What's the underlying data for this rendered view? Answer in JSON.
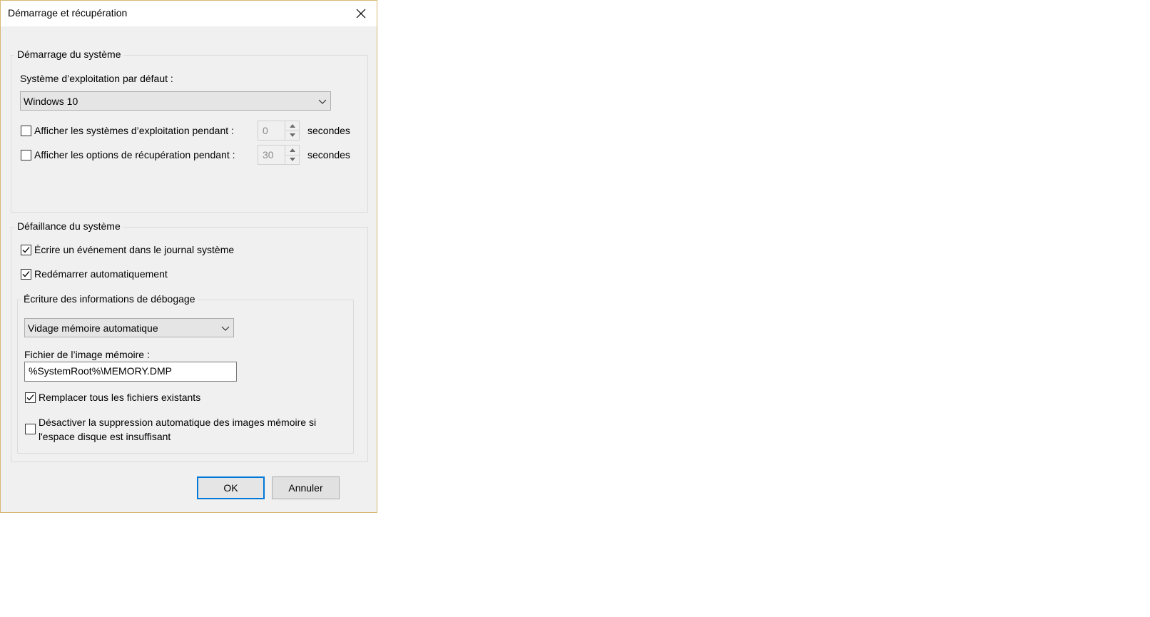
{
  "window": {
    "title": "Démarrage et récupération"
  },
  "startup": {
    "group_label": "Démarrage du système",
    "default_os_label": "Système d’exploitation par défaut :",
    "default_os_value": "Windows 10",
    "show_os_list": {
      "label": "Afficher les systèmes d’exploitation pendant :",
      "checked": false,
      "value": "0",
      "unit": "secondes"
    },
    "show_recovery": {
      "label": "Afficher les options de récupération pendant :",
      "checked": false,
      "value": "30",
      "unit": "secondes"
    }
  },
  "failure": {
    "group_label": "Défaillance du système",
    "write_event": {
      "label": "Écrire un événement dans le journal système",
      "checked": true
    },
    "auto_restart": {
      "label": "Redémarrer automatiquement",
      "checked": true
    },
    "debug": {
      "group_label": "Écriture des informations de débogage",
      "dump_type": "Vidage mémoire automatique",
      "dump_file_label": "Fichier de l’image mémoire :",
      "dump_file_value": "%SystemRoot%\\MEMORY.DMP",
      "overwrite": {
        "label": "Remplacer tous les fichiers existants",
        "checked": true
      },
      "disable_auto_delete": {
        "label_line1": "Désactiver la suppression automatique des images mémoire si",
        "label_line2": "l'espace disque est insuffisant",
        "checked": false
      }
    }
  },
  "buttons": {
    "ok": "OK",
    "cancel": "Annuler"
  },
  "icons": {
    "close": "close-icon",
    "dropdown": "chevron-down-icon",
    "check": "checkmark-icon",
    "spin_up": "arrow-up-icon",
    "spin_down": "arrow-down-icon"
  },
  "colors": {
    "default_button_border": "#0078d7",
    "dialog_border": "#d8b974",
    "dialog_bg": "#f0f0f0"
  }
}
